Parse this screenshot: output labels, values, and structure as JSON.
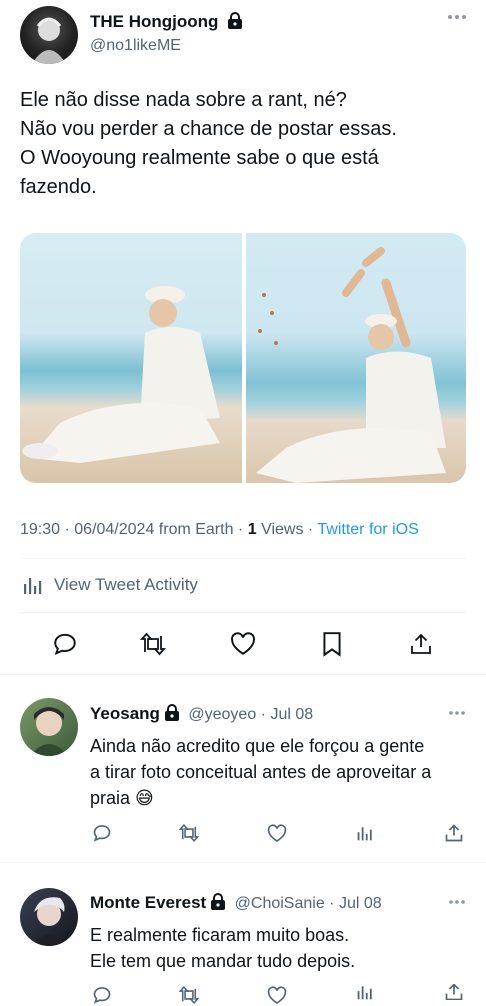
{
  "tweet": {
    "author_name": "THE Hongjoong",
    "author_handle": "@no1likeME",
    "text_lines": [
      "Ele não disse nada sobre a rant, né?",
      "Não vou perder a chance de postar essas.",
      "O Wooyoung realmente sabe o que está",
      "fazendo."
    ],
    "time": "19:30",
    "date": "06/04/2024 from Earth",
    "views_count": "1",
    "views_label": "Views",
    "source": "Twitter for iOS",
    "activity_label": "View Tweet Activity",
    "more_icon": "more-icon"
  },
  "replies": [
    {
      "name": "Yeosang",
      "handle": "@yeoyeo",
      "date": "Jul 08",
      "lines": [
        "Ainda não acredito que ele forçou a gente",
        "a tirar foto conceitual antes de aproveitar a",
        "praia"
      ],
      "emoji": "😅"
    },
    {
      "name": "Monte Everest",
      "handle": "@ChoiSanie",
      "date": "Jul 08",
      "lines": [
        "E realmente ficaram muito boas.",
        "Ele tem que mandar tudo depois."
      ]
    }
  ],
  "colors": {
    "text": "#0f1419",
    "secondary": "#536471",
    "link": "#1d9bf0",
    "divider": "#eff3f4"
  }
}
